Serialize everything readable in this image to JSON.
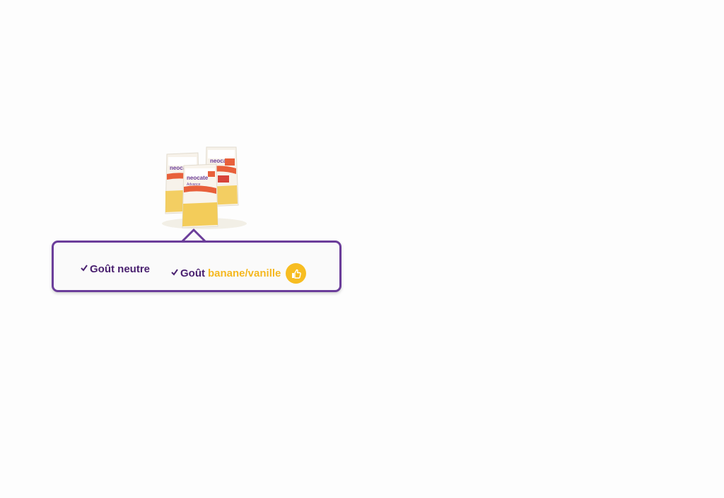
{
  "product": {
    "brand": "neocate",
    "image_icon": "neocate-sachets-image"
  },
  "options": [
    {
      "prefix": "Goût neutre",
      "highlight": ""
    },
    {
      "prefix": "Goût",
      "highlight": "banane/vanille",
      "badge_icon": "thumbs-up-icon"
    }
  ],
  "colors": {
    "accent_purple": "#6b3d9a",
    "text_purple": "#4a2170",
    "highlight_yellow": "#f5b81f"
  }
}
